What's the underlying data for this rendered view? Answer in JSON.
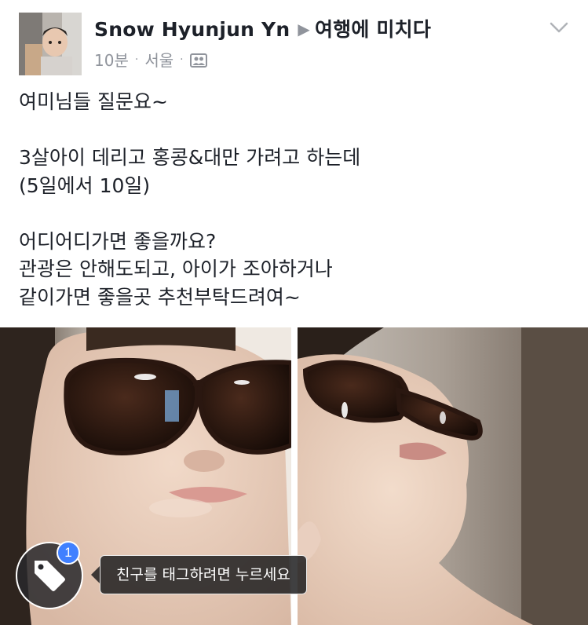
{
  "post": {
    "author": "Snow Hyunjun Yn",
    "group": "여행에 미치다",
    "time": "10분",
    "location": "서울",
    "separator": "·",
    "audience_icon": "friends-icon",
    "options_icon": "chevron-down-icon",
    "lines": [
      "여미님들 질문요~",
      "",
      "3살아이 데리고 홍콩&대만 가려고 하는데",
      "(5일에서 10일)",
      "",
      "어디어디가면 좋을까요?",
      "관광은 안해도되고, 아이가 조아하거나",
      "같이가면 좋을곳 추천부탁드려여~"
    ]
  },
  "photos": [
    {
      "id": "photo-left",
      "subject": "child wearing sunglasses, facing forward"
    },
    {
      "id": "photo-right",
      "subject": "child wearing sunglasses, looking up"
    }
  ],
  "tag": {
    "icon": "tag-icon",
    "badge_count": "1",
    "tooltip": "친구를 태그하려면 누르세요"
  },
  "colors": {
    "text": "#1d2129",
    "meta": "#90949c",
    "badge": "#4080ff"
  }
}
